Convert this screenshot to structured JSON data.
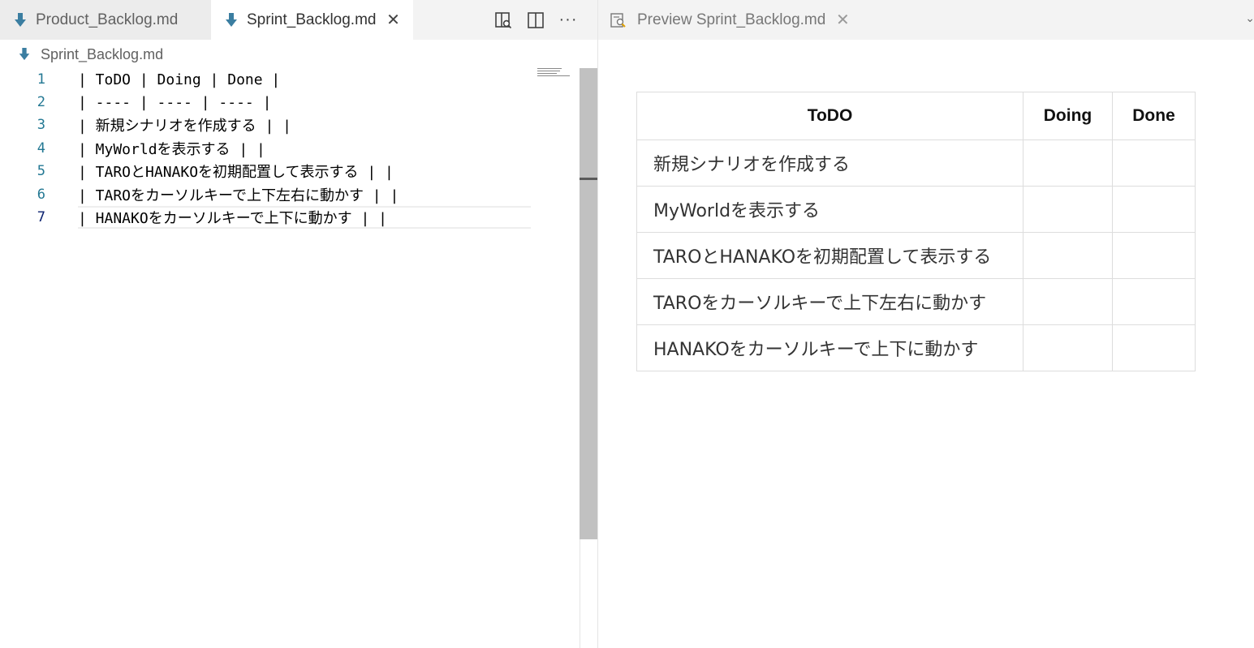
{
  "left_editor": {
    "tabs": [
      {
        "label": "Product_Backlog.md",
        "active": false
      },
      {
        "label": "Sprint_Backlog.md",
        "active": true,
        "close_glyph": "✕"
      }
    ],
    "breadcrumb": "Sprint_Backlog.md",
    "actions": [
      {
        "name": "open-preview-to-side-icon"
      },
      {
        "name": "split-editor-icon"
      },
      {
        "name": "more-actions-icon",
        "glyph": "···"
      }
    ],
    "lines": [
      {
        "number": "1",
        "text": "| ToDO | Doing | Done |"
      },
      {
        "number": "2",
        "text": "| ---- | ---- | ---- |"
      },
      {
        "number": "3",
        "text": "| 新規シナリオを作成する | |"
      },
      {
        "number": "4",
        "text": "| MyWorldを表示する | |"
      },
      {
        "number": "5",
        "text": "| TAROとHANAKOを初期配置して表示する | |"
      },
      {
        "number": "6",
        "text": "| TAROをカーソルキーで上下左右に動かす | |"
      },
      {
        "number": "7",
        "text": "| HANAKOをカーソルキーで上下に動かす | |"
      }
    ]
  },
  "preview": {
    "tab_label": "Preview Sprint_Backlog.md",
    "close_glyph": "✕",
    "table": {
      "headers": [
        "ToDO",
        "Doing",
        "Done"
      ],
      "rows": [
        [
          "新規シナリオを作成する",
          "",
          ""
        ],
        [
          "MyWorldを表示する",
          "",
          ""
        ],
        [
          "TAROとHANAKOを初期配置して表示する",
          "",
          ""
        ],
        [
          "TAROをカーソルキーで上下左右に動かす",
          "",
          ""
        ],
        [
          "HANAKOをカーソルキーで上下に動かす",
          "",
          ""
        ]
      ]
    }
  },
  "colors": {
    "line_number": "#237893",
    "md_icon": "#3b7ea1",
    "tabbar_bg": "#f3f3f3"
  }
}
